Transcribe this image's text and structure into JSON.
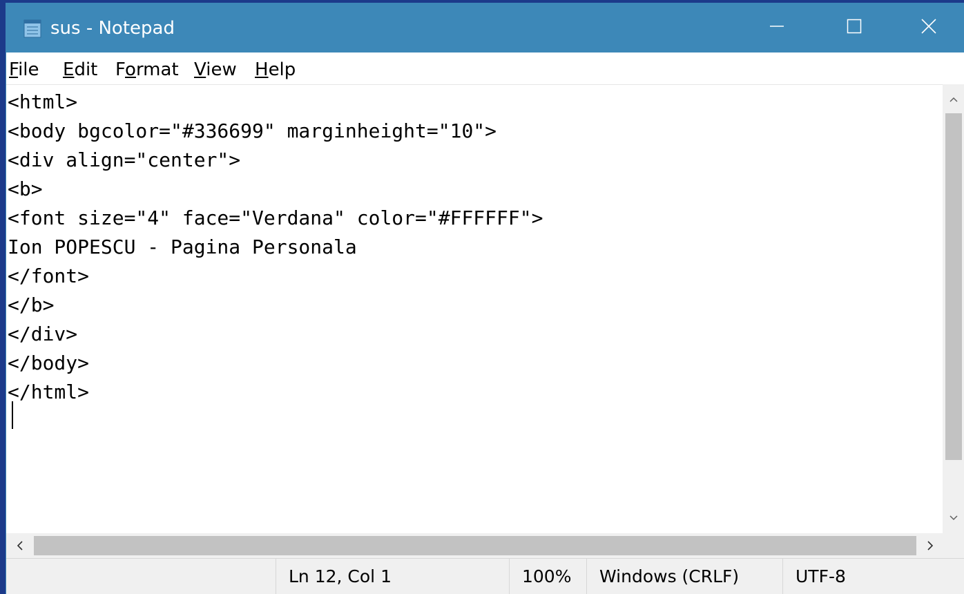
{
  "window": {
    "title": "sus - Notepad",
    "titlebar_color": "#3d88b8",
    "icons": {
      "app": "notepad-icon",
      "minimize": "minimize-icon",
      "maximize": "maximize-icon",
      "close": "close-icon"
    }
  },
  "menu": {
    "file": {
      "mnemonic": "F",
      "rest": "ile"
    },
    "edit": {
      "mnemonic": "E",
      "rest": "dit"
    },
    "format": {
      "pre": "F",
      "mnemonic": "o",
      "rest": "rmat"
    },
    "view": {
      "mnemonic": "V",
      "rest": "iew"
    },
    "help": {
      "mnemonic": "H",
      "rest": "elp"
    }
  },
  "editor": {
    "lines": [
      "<html>",
      "<body bgcolor=\"#336699\" marginheight=\"10\">",
      "<div align=\"center\">",
      "<b>",
      "<font size=\"4\" face=\"Verdana\" color=\"#FFFFFF\">",
      "Ion POPESCU - Pagina Personala",
      "</font>",
      "</b>",
      "</div>",
      "</body>",
      "</html>"
    ]
  },
  "statusbar": {
    "position": "Ln 12, Col 1",
    "zoom": "100%",
    "line_endings": "Windows (CRLF)",
    "encoding": "UTF-8"
  }
}
